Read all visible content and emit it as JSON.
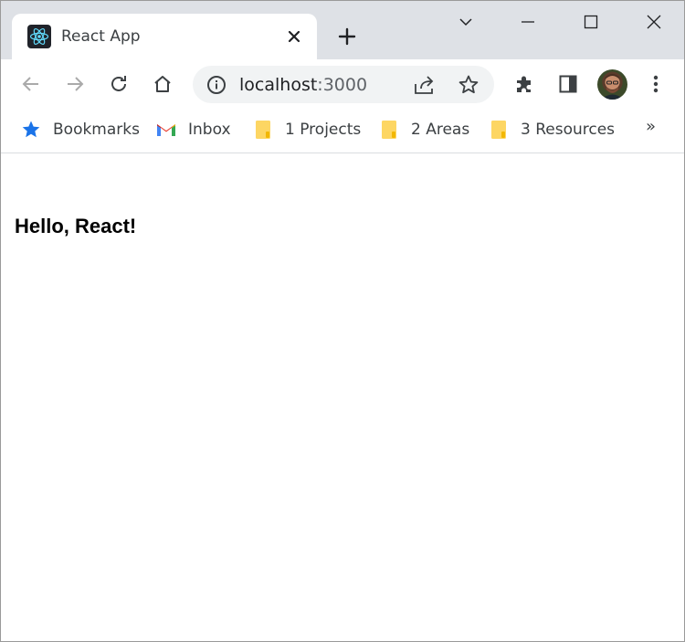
{
  "tab": {
    "title": "React App",
    "favicon": "react-logo-icon"
  },
  "omnibox": {
    "host": "localhost",
    "port": ":3000"
  },
  "bookmarks": [
    {
      "label": "Bookmarks",
      "icon": "star-icon"
    },
    {
      "label": "Inbox",
      "icon": "gmail-icon"
    },
    {
      "label": "1 Projects",
      "icon": "folder-icon"
    },
    {
      "label": "2 Areas",
      "icon": "folder-icon"
    },
    {
      "label": "3 Resources",
      "icon": "folder-icon"
    }
  ],
  "bookmarks_more": "»",
  "page": {
    "heading": "Hello, React!"
  },
  "colors": {
    "tabstrip": "#dee1e6",
    "omnibox": "#f1f3f4",
    "accent_blue": "#1a73e8",
    "folder": "#fdd663"
  }
}
